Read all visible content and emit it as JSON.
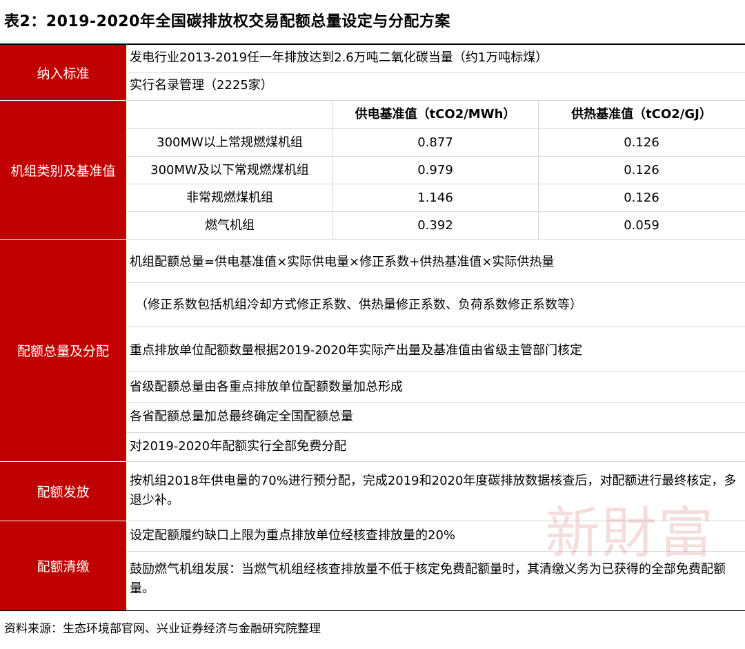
{
  "title": "表2：2019-2020年全国碳排放权交易配额总量设定与分配方案",
  "sections": {
    "inclusion": {
      "label": "纳入标准",
      "lines": [
        "发电行业2013-2019任一年排放达到2.6万吨二氧化碳当量（约1万吨标煤）",
        "实行名录管理（2225家）"
      ]
    },
    "units": {
      "label": "机组类别及基准值",
      "headers": [
        "",
        "供电基准值（tCO2/MWh）",
        "供热基准值（tCO2/GJ）"
      ],
      "rows": [
        [
          "300MW以上常规燃煤机组",
          "0.877",
          "0.126"
        ],
        [
          "300MW及以下常规燃煤机组",
          "0.979",
          "0.126"
        ],
        [
          "非常规燃煤机组",
          "1.146",
          "0.126"
        ],
        [
          "燃气机组",
          "0.392",
          "0.059"
        ]
      ]
    },
    "allocation": {
      "label": "配额总量及分配",
      "lines": [
        "机组配额总量=供电基准值×实际供电量×修正系数+供热基准值×实际供热量",
        "（修正系数包括机组冷却方式修正系数、供热量修正系数、负荷系数修正系数等）",
        "重点排放单位配额数量根据2019-2020年实际产出量及基准值由省级主管部门核定",
        "省级配额总量由各重点排放单位配额数量加总形成",
        "各省配额总量加总最终确定全国配额总量",
        "对2019-2020年配额实行全部免费分配"
      ]
    },
    "issuance": {
      "label": "配额发放",
      "lines": [
        "按机组2018年供电量的70%进行预分配，完成2019和2020年度碳排放数据核查后，对配额进行最终核定，多退少补。"
      ]
    },
    "settlement": {
      "label": "配额清缴",
      "lines": [
        "设定配额履约缺口上限为重点排放单位经核查排放量的20%",
        "鼓励燃气机组发展：当燃气机组经核查排放量不低于核定免费配额量时，其清缴义务为已获得的全部免费配额量。"
      ]
    }
  },
  "source": "资料来源：生态环境部官网、兴业证券经济与金融研究院整理",
  "watermark": "新財富",
  "colors": {
    "accent": "#c00000",
    "grid": "#d6d6d6"
  }
}
